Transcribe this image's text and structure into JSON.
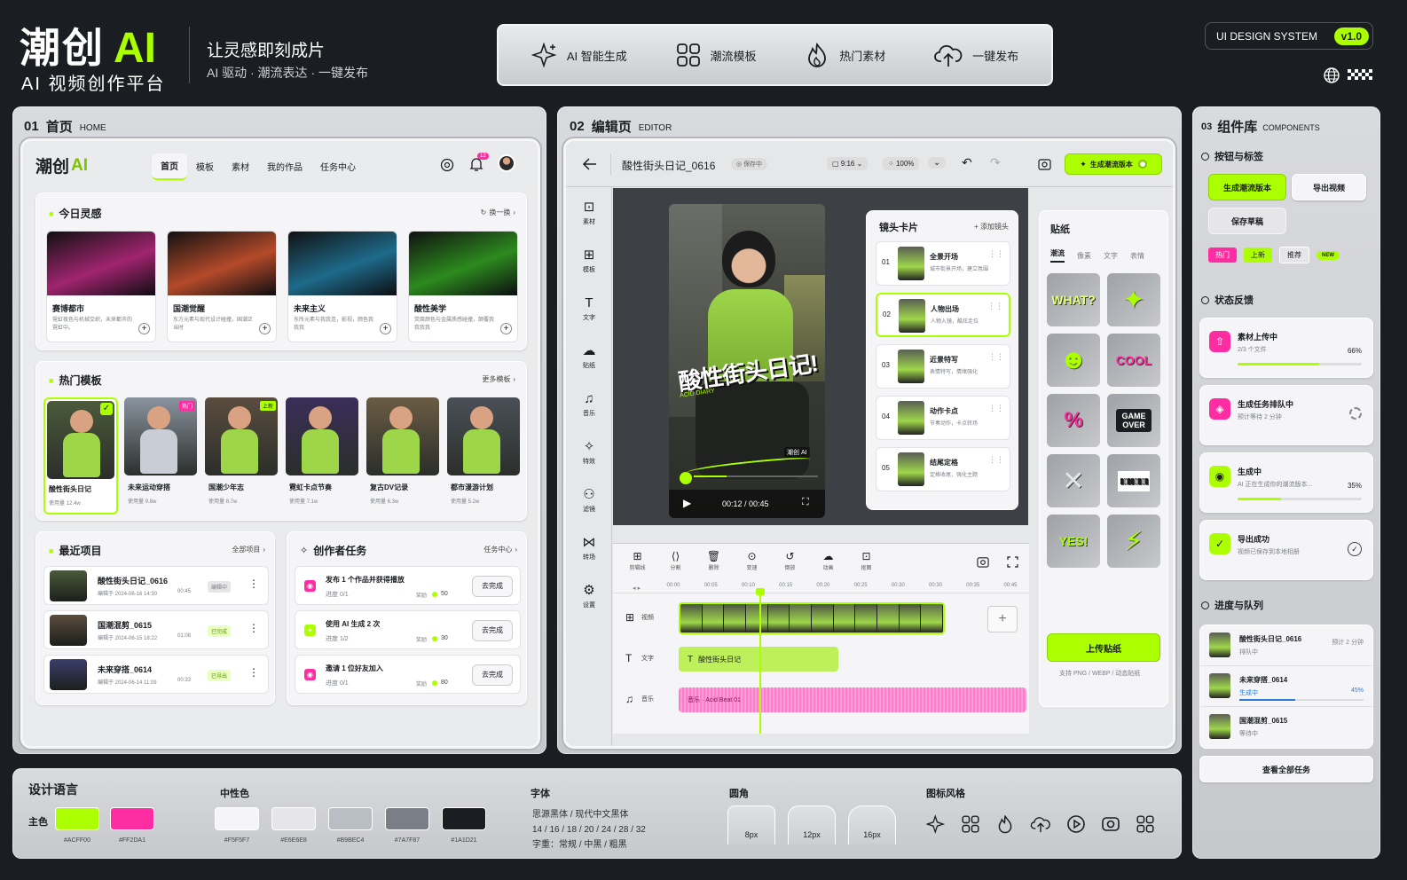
{
  "brand": {
    "title_cn": "潮创",
    "title_ai": "AI",
    "subtitle": "AI 视频创作平台",
    "slogan": "让灵感即刻成片",
    "sub_slogan": "AI 驱动 · 潮流表达 · 一键发布"
  },
  "topnav": [
    {
      "label": "AI 智能生成",
      "icon": "sparkle-icon"
    },
    {
      "label": "潮流模板",
      "icon": "grid-icon"
    },
    {
      "label": "热门素材",
      "icon": "flame-icon"
    },
    {
      "label": "一键发布",
      "icon": "cloud-upload-icon"
    }
  ],
  "ds_badge": {
    "label": "UI DESIGN SYSTEM",
    "version": "v1.0"
  },
  "home": {
    "section_num": "01",
    "section_title": "首页",
    "section_en": "HOME",
    "logo_cn": "潮创",
    "logo_ai": "AI",
    "nav": [
      "首页",
      "模板",
      "素材",
      "我的作品",
      "任务中心"
    ],
    "notif_count": "12",
    "inspiration": {
      "title": "今日灵感",
      "action": "换一换",
      "cards": [
        {
          "title": "赛博都市",
          "desc": "霓虹夜色与机械交织，未来都市的霓虹中。",
          "color": "#a0246f"
        },
        {
          "title": "国潮觉醒",
          "desc": "东方元素与现代设计碰撞，国潮正当时",
          "color": "#b44a2a"
        },
        {
          "title": "未来主义",
          "desc": "东所元素与我我连，影视，颜色我我我",
          "color": "#1e6a8a"
        },
        {
          "title": "酸性美学",
          "desc": "荧腐颜色与金属质感碰撞，颠覆我我我我",
          "color": "#2c8a1e"
        }
      ]
    },
    "templates": {
      "title": "热门模板",
      "action": "更多模板",
      "items": [
        {
          "name": "酸性街头日记",
          "uses": "使用量 12.4w",
          "tag": ""
        },
        {
          "name": "未来运动穿搭",
          "uses": "使用量 9.8w",
          "tag": "热门"
        },
        {
          "name": "国潮少年志",
          "uses": "使用量 8.7w",
          "tag": "上新"
        },
        {
          "name": "霓虹卡点节奏",
          "uses": "使用量 7.1w",
          "tag": ""
        },
        {
          "name": "复古DV记录",
          "uses": "使用量 6.3w",
          "tag": ""
        },
        {
          "name": "都市漫游计划",
          "uses": "使用量 5.2w",
          "tag": ""
        }
      ]
    },
    "recent": {
      "title": "最近项目",
      "action": "全部项目",
      "items": [
        {
          "name": "酸性街头日记_0616",
          "meta": "编辑于 2024-06-16 14:30",
          "dur": "00:45",
          "status": "编辑中"
        },
        {
          "name": "国潮混剪_0615",
          "meta": "编辑于 2024-06-15 18:22",
          "dur": "01:08",
          "status": "已完成"
        },
        {
          "name": "未来穿搭_0614",
          "meta": "编辑于 2024-06-14 11:09",
          "dur": "00:33",
          "status": "已导出"
        }
      ]
    },
    "tasks": {
      "title": "创作者任务",
      "action": "任务中心",
      "items": [
        {
          "name": "发布 1 个作品并获得播放",
          "progress": "进度  0/1",
          "reward": "奖励",
          "points": "50",
          "btn": "去完成"
        },
        {
          "name": "使用 AI 生成 2 次",
          "progress": "进度  1/2",
          "reward": "奖励",
          "points": "30",
          "btn": "去完成"
        },
        {
          "name": "邀请 1 位好友加入",
          "progress": "进度  0/1",
          "reward": "奖励",
          "points": "80",
          "btn": "去完成"
        }
      ]
    }
  },
  "editor": {
    "section_num": "02",
    "section_title": "编辑页",
    "section_en": "EDITOR",
    "project": "酸性街头日记_0616",
    "save_state": "保存中",
    "ratio": "9:16",
    "zoom": "100%",
    "generate": "生成潮流版本",
    "tools": [
      "素材",
      "模板",
      "文字",
      "贴纸",
      "音乐",
      "特效",
      "滤镜",
      "转场",
      "设置"
    ],
    "video": {
      "title": "酸性街头日记!",
      "sub": "ACID DIARY",
      "time": "00:12 / 00:45",
      "watermark": "潮创 AI"
    },
    "shots": {
      "title": "镜头卡片",
      "action": "+ 添加镜头",
      "items": [
        {
          "n": "01",
          "t": "全景开场",
          "d": "城市街景开场，建立氛围"
        },
        {
          "n": "02",
          "t": "人物出场",
          "d": "人物入镜，酷炫走位"
        },
        {
          "n": "03",
          "t": "近景特写",
          "d": "表情特写，情绪强化"
        },
        {
          "n": "04",
          "t": "动作卡点",
          "d": "节奏动作，卡点转场"
        },
        {
          "n": "05",
          "t": "结尾定格",
          "d": "定格收尾，强化主题"
        }
      ]
    },
    "stickers": {
      "title": "贴纸",
      "tabs": [
        "潮流",
        "像素",
        "文字",
        "表情"
      ],
      "upload": "上传贴纸",
      "hint": "支持 PNG / WEBP / 动态贴纸",
      "labels": [
        "WHAT?",
        "COOL",
        "%",
        "GAME OVER",
        "YES!"
      ]
    },
    "timeline": {
      "tools": [
        "剪辑线",
        "分割",
        "删除",
        "变速",
        "倒放",
        "动画",
        "抠图"
      ],
      "ticks": [
        "00:00",
        "00:05",
        "00:10",
        "00:15",
        "00:20",
        "00:25",
        "00:30",
        "00:30",
        "00:35",
        "00:45"
      ],
      "tracks": [
        "视频",
        "文字",
        "音乐"
      ],
      "text_clip": "酸性街头日记",
      "music_clip": "音乐 · Acid Beat 01"
    }
  },
  "components": {
    "section_num": "03",
    "section_title": "组件库",
    "section_en": "COMPONENTS",
    "buttons": {
      "title": "按钮与标签",
      "primary": "生成潮流版本",
      "secondary": "导出视频",
      "tertiary": "保存草稿",
      "tags": [
        "热门",
        "上新",
        "推荐",
        "NEW"
      ]
    },
    "status": {
      "title": "状态反馈",
      "items": [
        {
          "t": "素材上传中",
          "d": "2/3 个文件",
          "pct": "66%",
          "fill": 0.66
        },
        {
          "t": "生成任务排队中",
          "d": "预计等待 2 分钟",
          "pct": "",
          "fill": 0
        },
        {
          "t": "生成中",
          "d": "AI 正在生成你的潮流版本...",
          "pct": "35%",
          "fill": 0.35
        },
        {
          "t": "导出成功",
          "d": "视频已保存到本地相册",
          "pct": "",
          "fill": 0
        }
      ]
    },
    "queue": {
      "title": "进度与队列",
      "items": [
        {
          "t": "酸性街头日记_0616",
          "s": "排队中",
          "r": "预计 2 分钟"
        },
        {
          "t": "未来穿搭_0614",
          "s": "生成中",
          "r": "45%",
          "fill": 0.45
        },
        {
          "t": "国潮混剪_0615",
          "s": "等待中",
          "r": ""
        }
      ],
      "all": "查看全部任务"
    }
  },
  "design": {
    "title": "设计语言",
    "primary_label": "主色",
    "primary": [
      {
        "hex": "#ACFF00"
      },
      {
        "hex": "#FF2DA1"
      }
    ],
    "neutral_label": "中性色",
    "neutral": [
      {
        "hex": "#F5F5F7"
      },
      {
        "hex": "#E6E6E8"
      },
      {
        "hex": "#B9BEC4"
      },
      {
        "hex": "#7A7F87"
      },
      {
        "hex": "#1A1D21"
      }
    ],
    "font_label": "字体",
    "font_lines": [
      "思源黑体 / 现代中文黑体",
      "14 / 16 / 18 / 20 / 24 / 28 / 32",
      "字重：常规 / 中黑 / 粗黑"
    ],
    "radius_label": "圆角",
    "radius": [
      "8px",
      "12px",
      "16px"
    ],
    "icon_label": "图标风格"
  }
}
